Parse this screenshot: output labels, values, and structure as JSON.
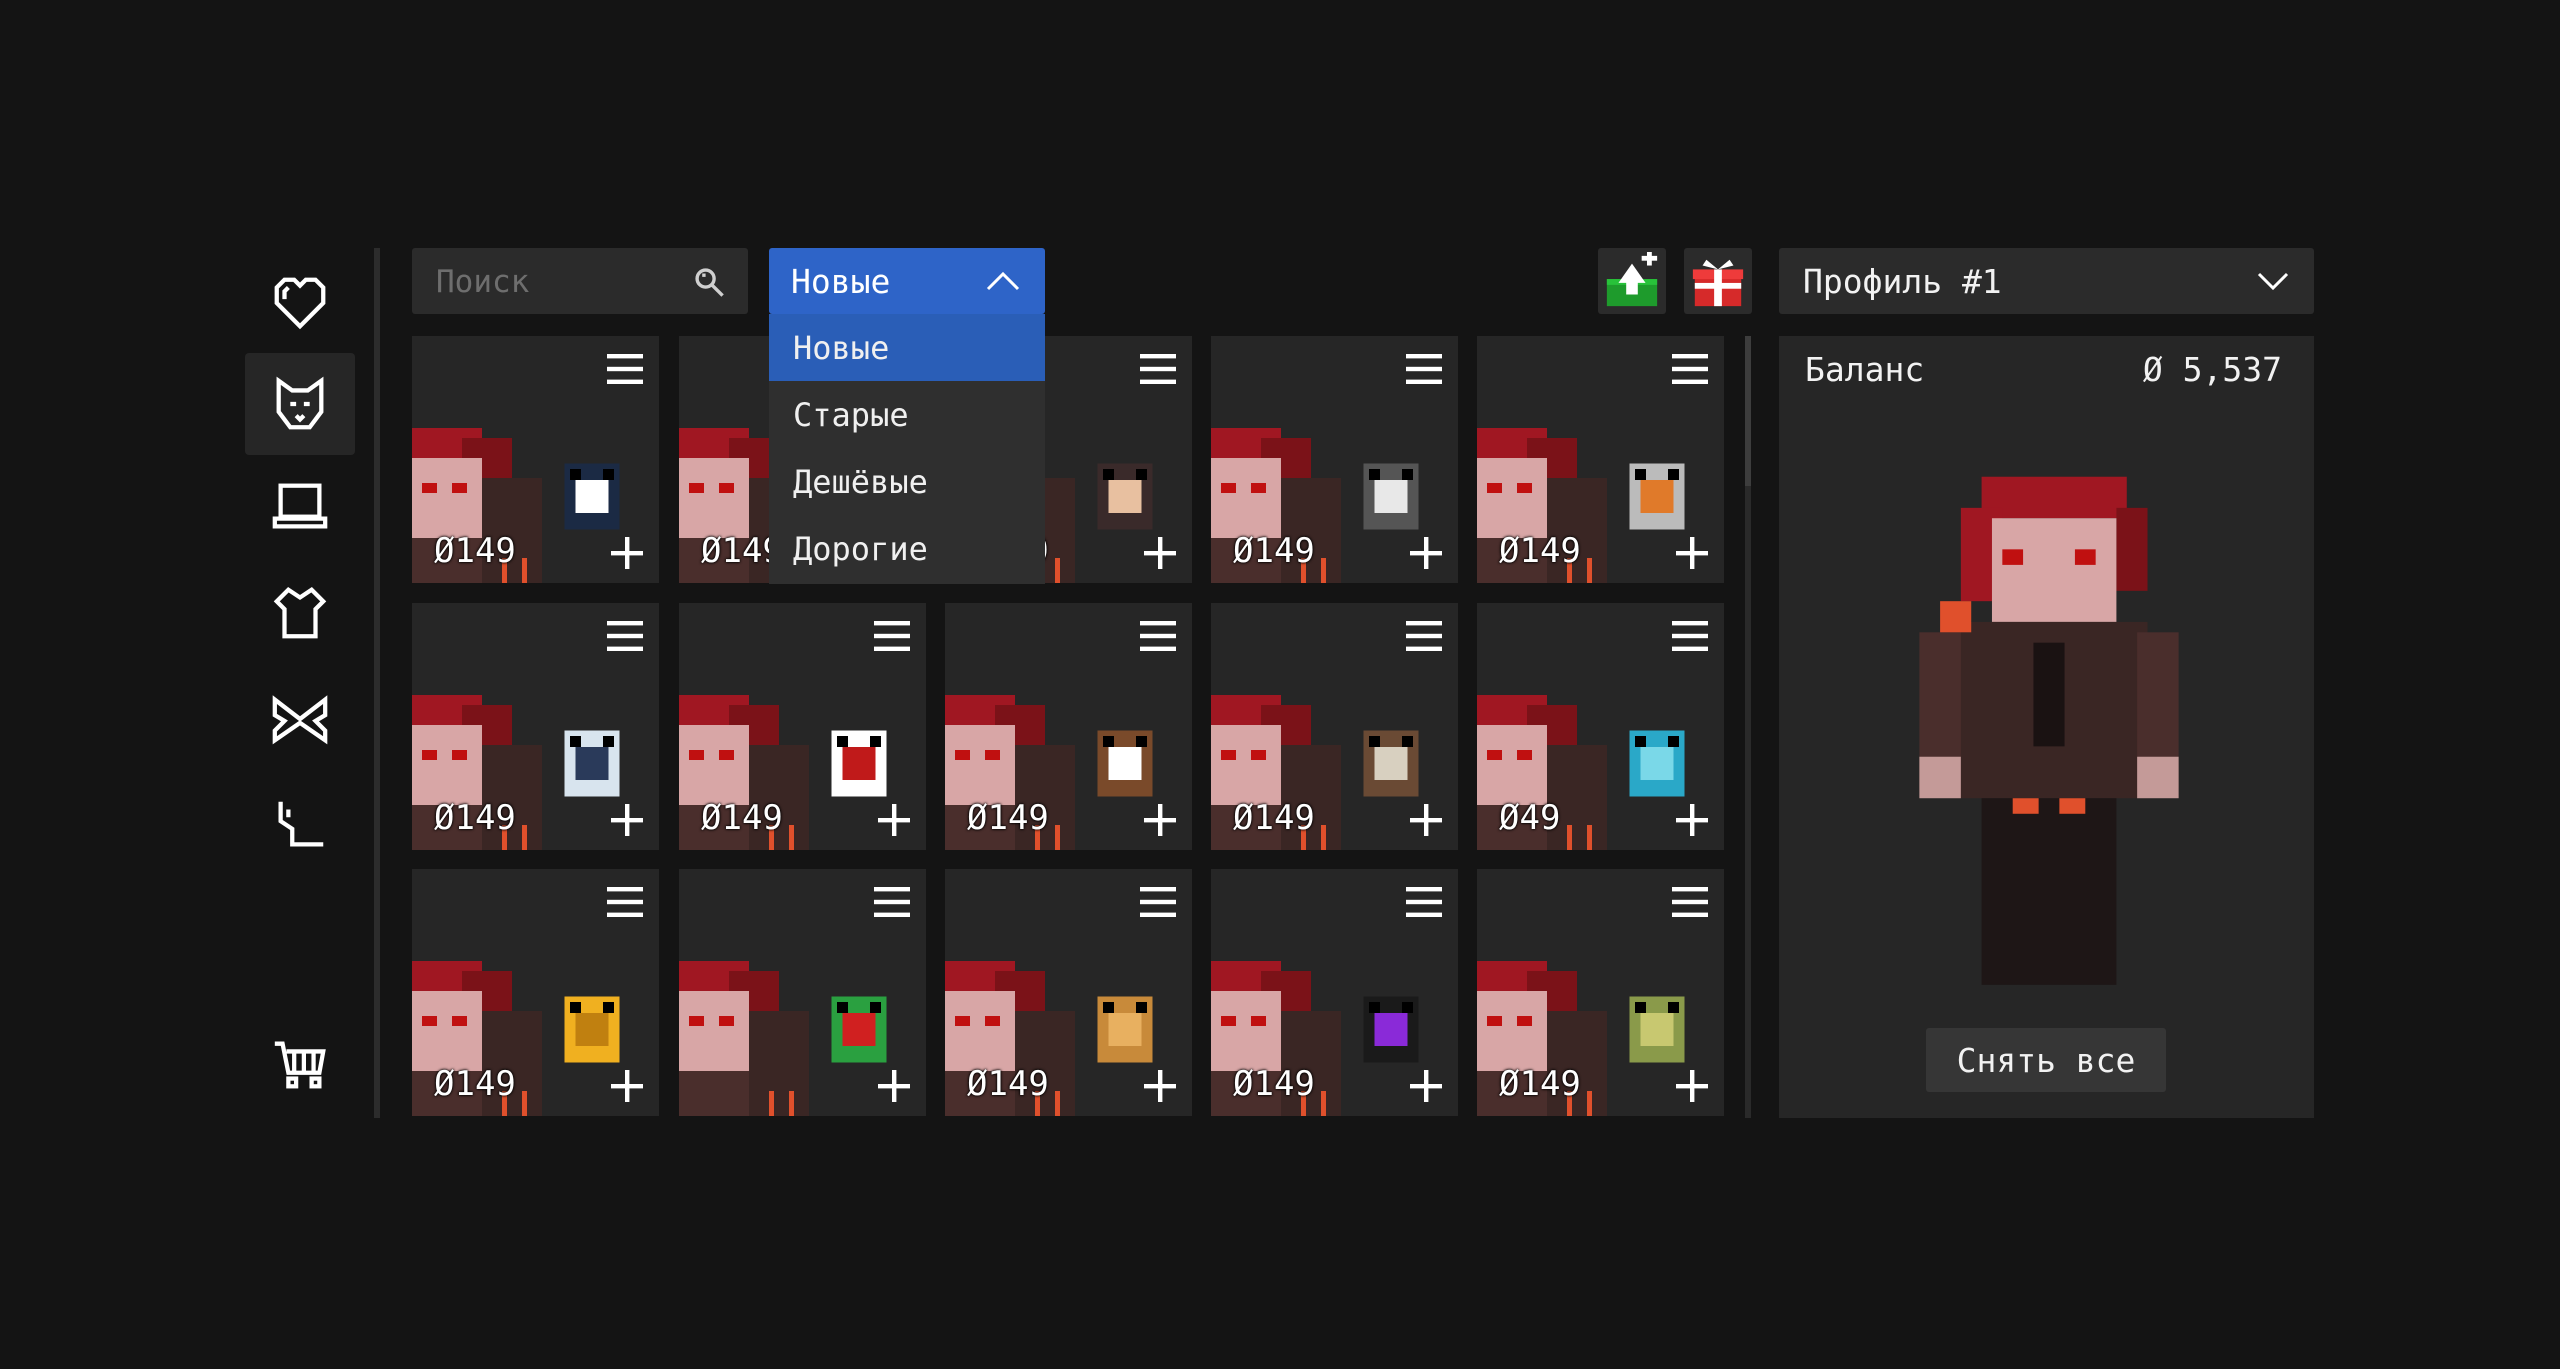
{
  "nav": {
    "items": [
      {
        "name": "favorites",
        "icon": "heart-icon"
      },
      {
        "name": "pets",
        "icon": "cat-icon"
      },
      {
        "name": "devices",
        "icon": "laptop-icon"
      },
      {
        "name": "clothes",
        "icon": "shirt-icon"
      },
      {
        "name": "wings",
        "icon": "butterfly-icon"
      },
      {
        "name": "tails",
        "icon": "tail-icon"
      }
    ],
    "cart_icon": "cart-icon"
  },
  "search": {
    "placeholder": "Поиск",
    "value": ""
  },
  "sort": {
    "selected": "Новые",
    "options": [
      "Новые",
      "Старые",
      "Дешёвые",
      "Дорогие"
    ]
  },
  "top_actions": {
    "upload_icon": "upload-icon",
    "gift_icon": "gift-icon"
  },
  "profile": {
    "selected": "Профиль #1"
  },
  "items": [
    {
      "price": "149",
      "pet": "orca"
    },
    {
      "price": "149",
      "pet": "bow"
    },
    {
      "price": "149",
      "pet": "girl"
    },
    {
      "price": "149",
      "pet": "raccoon"
    },
    {
      "price": "149",
      "pet": "bunny"
    },
    {
      "price": "149",
      "pet": "penguin"
    },
    {
      "price": "149",
      "pet": "candy-cane"
    },
    {
      "price": "149",
      "pet": "gingerbread"
    },
    {
      "price": "149",
      "pet": "deer"
    },
    {
      "price": "49",
      "pet": "sock"
    },
    {
      "price": "149",
      "pet": "gamepad"
    },
    {
      "price": "",
      "pet": "elf"
    },
    {
      "price": "149",
      "pet": "squirrel"
    },
    {
      "price": "149",
      "pet": "enderman"
    },
    {
      "price": "149",
      "pet": "turtle"
    }
  ],
  "panel": {
    "balance_label": "Баланс",
    "balance_value": "5,537",
    "remove_all": "Снять все"
  },
  "colors": {
    "accent": "#2e64c8",
    "background": "#141414",
    "card": "#262626",
    "hair": "#a01722"
  }
}
